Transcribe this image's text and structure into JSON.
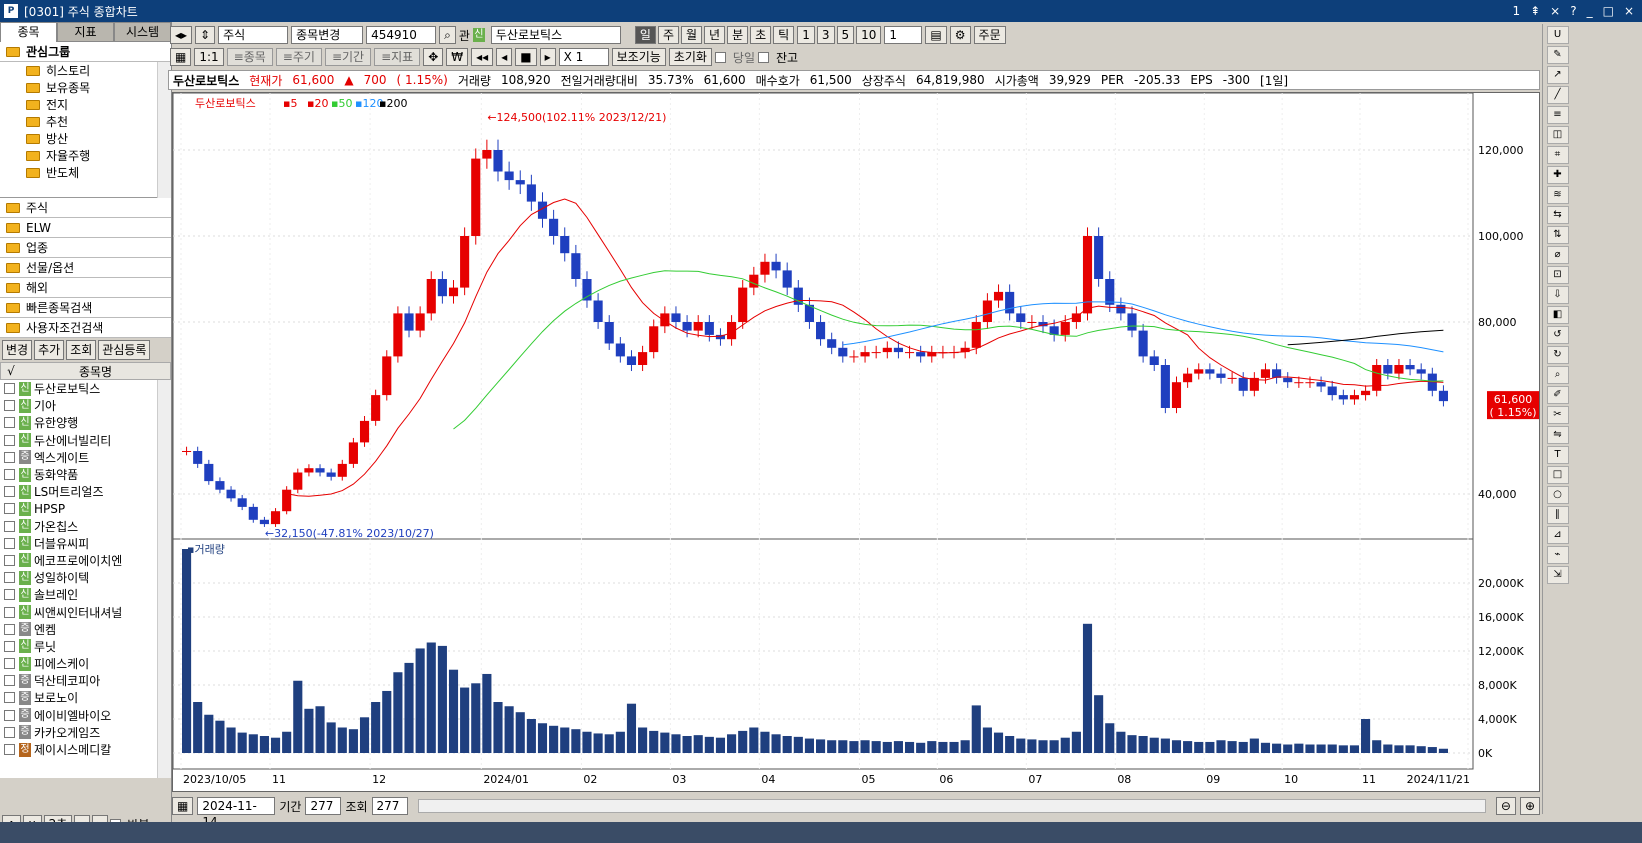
{
  "window": {
    "title": "[0301] 주식 종합차트",
    "logo": "P",
    "controls": [
      "1",
      "⇞",
      "⨯",
      "?",
      "_",
      "□",
      "×"
    ]
  },
  "left": {
    "tabs": [
      "종목",
      "지표",
      "시스템"
    ],
    "group_header": "관심그룹",
    "tree": [
      "히스토리",
      "보유종목",
      "전지",
      "추천",
      "방산",
      "자율주행",
      "반도체"
    ],
    "categories": [
      "주식",
      "ELW",
      "업종",
      "선물/옵션",
      "해외",
      "빠른종목검색",
      "사용자조건검색"
    ],
    "buttons": [
      "변경",
      "추가",
      "조회",
      "관심등록"
    ],
    "list_header": {
      "check": "√",
      "name": "종목명"
    },
    "stocks": [
      {
        "b": "신",
        "c": "new",
        "n": "두산로보틱스"
      },
      {
        "b": "신",
        "c": "new",
        "n": "기아"
      },
      {
        "b": "신",
        "c": "new",
        "n": "유한양행"
      },
      {
        "b": "신",
        "c": "new",
        "n": "두산에너빌리티"
      },
      {
        "b": "증",
        "c": "jeung",
        "n": "엑스게이트"
      },
      {
        "b": "신",
        "c": "new",
        "n": "동화약품"
      },
      {
        "b": "신",
        "c": "new",
        "n": "LS머트리얼즈"
      },
      {
        "b": "신",
        "c": "new",
        "n": "HPSP"
      },
      {
        "b": "신",
        "c": "new",
        "n": "가온칩스"
      },
      {
        "b": "신",
        "c": "new",
        "n": "더블유씨피"
      },
      {
        "b": "신",
        "c": "new",
        "n": "에코프로에이치엔"
      },
      {
        "b": "신",
        "c": "new",
        "n": "성일하이텍"
      },
      {
        "b": "신",
        "c": "new",
        "n": "솔브레인"
      },
      {
        "b": "신",
        "c": "new",
        "n": "씨앤씨인터내셔널"
      },
      {
        "b": "증",
        "c": "jeung",
        "n": "엔켐"
      },
      {
        "b": "신",
        "c": "new",
        "n": "루닛"
      },
      {
        "b": "신",
        "c": "new",
        "n": "피에스케이"
      },
      {
        "b": "증",
        "c": "jeung",
        "n": "덕산테코피아"
      },
      {
        "b": "증",
        "c": "jeung",
        "n": "보로노이"
      },
      {
        "b": "증",
        "c": "jeung",
        "n": "에이비엘바이오"
      },
      {
        "b": "증",
        "c": "jeung",
        "n": "카카오게임즈"
      },
      {
        "b": "정",
        "c": "jeong",
        "n": "제이시스메디칼"
      }
    ],
    "bottom": {
      "interval": "2초",
      "repeat": "반복"
    }
  },
  "toolbar": {
    "market": "주식",
    "change": "종목변경",
    "code": "454910",
    "gwan": "관",
    "badge": "신",
    "stock_name": "두산로보틱스",
    "periods": [
      "일",
      "주",
      "월",
      "년",
      "분",
      "초",
      "틱"
    ],
    "active_period": "일",
    "nums": [
      "1",
      "3",
      "5",
      "10"
    ],
    "num_value": "1",
    "order": "주문",
    "row2": [
      "≡종목",
      "≡주기",
      "≡기간",
      "≡지표"
    ],
    "mult": "X 1",
    "aux": "보조기능",
    "reset": "초기화",
    "today": "당일",
    "balance": "잔고"
  },
  "info": {
    "name": "두산로보틱스",
    "cur_label": "현재가",
    "price": "61,600",
    "arrow": "▲",
    "change": "700",
    "pct": "( 1.15%)",
    "vol_label": "거래량",
    "vol": "108,920",
    "prev_label": "전일거래량대비",
    "prev": "35.73%",
    "ask": "61,600",
    "bid_label": "매수호가",
    "bid": "61,500",
    "shares_label": "상장주식",
    "shares": "64,819,980",
    "cap_label": "시가총액",
    "cap": "39,929",
    "per_label": "PER",
    "per": "-205.33",
    "eps_label": "EPS",
    "eps": "-300",
    "period": "[1일]"
  },
  "chart_data": {
    "type": "candlestick",
    "legend": {
      "name": "두산로보틱스",
      "ma": [
        "5",
        "20",
        "50",
        "120",
        "200"
      ]
    },
    "ma_colors": [
      "#e60000",
      "#e60000",
      "#33cc33",
      "#1e90ff",
      "#000000"
    ],
    "y_ticks": [
      "120,000",
      "100,000",
      "80,000",
      "40,000"
    ],
    "x_ticks": [
      "2023/10/05",
      "11",
      "12",
      "2024/01",
      "02",
      "03",
      "04",
      "05",
      "06",
      "07",
      "08",
      "09",
      "10",
      "11",
      "2024/11/21"
    ],
    "high_note": "124,500(102.11% 2023/12/21)",
    "low_note": "32,150(-47.81% 2023/10/27)",
    "price_tag": "61,600",
    "pct_tag": "( 1.15%)",
    "closes": [
      50000,
      47000,
      43000,
      41000,
      39000,
      37000,
      34000,
      33000,
      36000,
      41000,
      45000,
      46000,
      45000,
      44000,
      47000,
      52000,
      57000,
      63000,
      72000,
      82000,
      78000,
      82000,
      90000,
      86000,
      88000,
      100000,
      118000,
      120000,
      115000,
      113000,
      112000,
      108000,
      104000,
      100000,
      96000,
      90000,
      85000,
      80000,
      75000,
      72000,
      70000,
      73000,
      79000,
      82000,
      80000,
      78000,
      80000,
      77000,
      76000,
      80000,
      88000,
      91000,
      94000,
      92000,
      88000,
      84000,
      80000,
      76000,
      74000,
      72000,
      72000,
      73000,
      73000,
      74000,
      73000,
      73000,
      72000,
      73000,
      73000,
      73000,
      74000,
      80000,
      85000,
      87000,
      82000,
      80000,
      80000,
      79000,
      77000,
      80000,
      82000,
      100000,
      90000,
      84000,
      82000,
      78000,
      72000,
      70000,
      60000,
      66000,
      68000,
      69000,
      68000,
      67000,
      67000,
      64000,
      67000,
      69000,
      67000,
      66000,
      66000,
      66000,
      65000,
      63000,
      62000,
      63000,
      64000,
      70000,
      68000,
      70000,
      69000,
      68000,
      64000,
      61600
    ],
    "volume_ticks": [
      "20,000K",
      "16,000K",
      "12,000K",
      "8,000K",
      "4,000K",
      "0K"
    ],
    "volume_label": "거래량",
    "volume": [
      24000,
      6000,
      4500,
      3800,
      3000,
      2400,
      2200,
      2000,
      1800,
      2500,
      8500,
      5200,
      5500,
      3600,
      3000,
      2800,
      4200,
      6000,
      7300,
      9500,
      10600,
      12300,
      13000,
      12600,
      9800,
      7700,
      8200,
      9300,
      6000,
      5500,
      4800,
      4000,
      3500,
      3200,
      3000,
      2800,
      2500,
      2300,
      2200,
      2500,
      5800,
      3000,
      2600,
      2400,
      2200,
      2000,
      2100,
      1900,
      1800,
      2200,
      2600,
      3000,
      2500,
      2200,
      2000,
      1900,
      1700,
      1600,
      1500,
      1500,
      1400,
      1500,
      1400,
      1300,
      1400,
      1300,
      1200,
      1400,
      1300,
      1300,
      1500,
      5600,
      3000,
      2400,
      2000,
      1700,
      1600,
      1500,
      1500,
      1800,
      2500,
      15200,
      6800,
      3500,
      2500,
      2100,
      2000,
      1800,
      1700,
      1500,
      1400,
      1300,
      1300,
      1500,
      1400,
      1300,
      1700,
      1200,
      1100,
      1000,
      1100,
      1000,
      1000,
      1000,
      900,
      900,
      4000,
      1500,
      1000,
      900,
      900,
      800,
      700,
      500
    ]
  },
  "bottom": {
    "date": "2024-11-14",
    "period_label": "기간",
    "period": "277",
    "view_label": "조회",
    "view": "277"
  }
}
